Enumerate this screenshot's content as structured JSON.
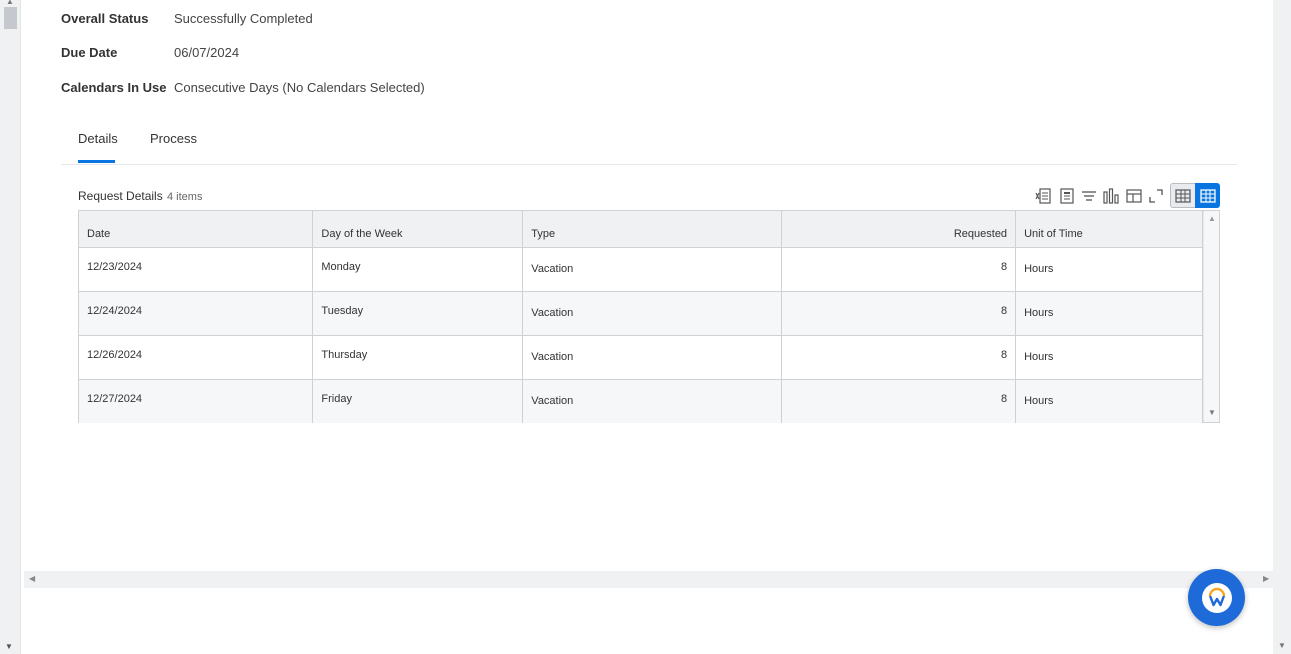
{
  "fields": [
    {
      "label": "Overall Status",
      "value": "Successfully Completed"
    },
    {
      "label": "Due Date",
      "value": "06/07/2024"
    },
    {
      "label": "Calendars In Use",
      "value": "Consecutive Days (No Calendars Selected)"
    }
  ],
  "tabs": [
    {
      "label": "Details",
      "active": true
    },
    {
      "label": "Process",
      "active": false
    }
  ],
  "grid": {
    "title": "Request Details",
    "count": "4 items",
    "columns": [
      "Date",
      "Day of the Week",
      "Type",
      "Requested",
      "Unit of Time"
    ],
    "rows": [
      {
        "date": "12/23/2024",
        "day": "Monday",
        "type": "Vacation",
        "requested": "8",
        "unit": "Hours"
      },
      {
        "date": "12/24/2024",
        "day": "Tuesday",
        "type": "Vacation",
        "requested": "8",
        "unit": "Hours"
      },
      {
        "date": "12/26/2024",
        "day": "Thursday",
        "type": "Vacation",
        "requested": "8",
        "unit": "Hours"
      },
      {
        "date": "12/27/2024",
        "day": "Friday",
        "type": "Vacation",
        "requested": "8",
        "unit": "Hours"
      }
    ]
  },
  "toolbar": {
    "icons": [
      "export-excel-icon",
      "export-pdf-icon",
      "filter-icon",
      "chart-icon",
      "configure-columns-icon",
      "fullscreen-icon",
      "table-view-icon",
      "grid-view-icon"
    ]
  },
  "colors": {
    "accent": "#0875e1",
    "assistant": "#1e6ad8",
    "header_bg": "#f0f1f2"
  }
}
